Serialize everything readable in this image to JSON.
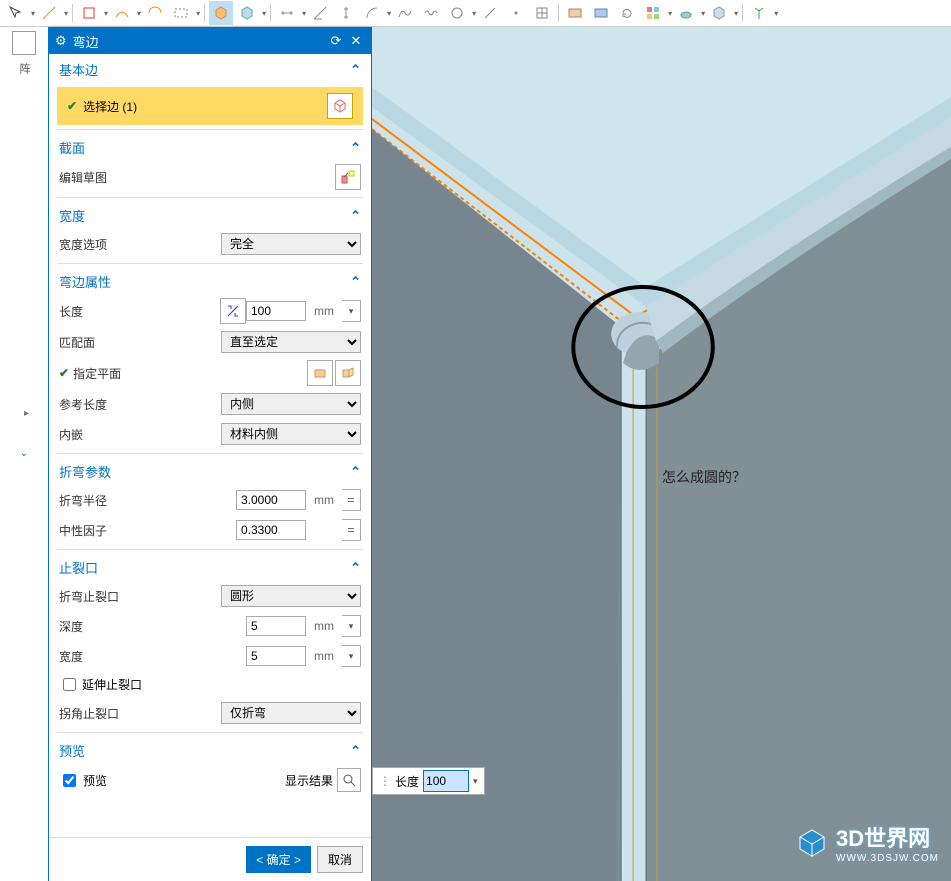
{
  "panel": {
    "title": "弯边",
    "section_basic": "基本边",
    "select_edge": "选择边 (1)",
    "section_cross": "截面",
    "edit_sketch": "编辑草图",
    "section_width": "宽度",
    "width_option_label": "宽度选项",
    "width_option_value": "完全",
    "section_bend_props": "弯边属性",
    "length_label": "长度",
    "length_value": "100",
    "length_unit": "mm",
    "match_face_label": "匹配面",
    "match_face_value": "直至选定",
    "specify_plane": "指定平面",
    "ref_length_label": "参考长度",
    "ref_length_value": "内侧",
    "inset_label": "内嵌",
    "inset_value": "材料内侧",
    "section_fold_params": "折弯参数",
    "bend_radius_label": "折弯半径",
    "bend_radius_value": "3.0000",
    "bend_radius_unit": "mm",
    "neutral_factor_label": "中性因子",
    "neutral_factor_value": "0.3300",
    "section_relief": "止裂口",
    "bend_relief_label": "折弯止裂口",
    "bend_relief_value": "圆形",
    "depth_label": "深度",
    "depth_value": "5",
    "depth_unit": "mm",
    "width2_label": "宽度",
    "width2_value": "5",
    "width2_unit": "mm",
    "extend_relief": "延伸止裂口",
    "corner_relief_label": "拐角止裂口",
    "corner_relief_value": "仅折弯",
    "section_preview": "预览",
    "preview_chk": "预览",
    "show_result": "显示结果",
    "ok": "< 确定 >",
    "cancel": "取消"
  },
  "floatbar": {
    "length_label": "长度",
    "length_value": "100"
  },
  "viewport": {
    "annotation": "怎么成圆的？"
  },
  "watermark": {
    "title": "3D世界网",
    "url": "WWW.3DSJW.COM"
  },
  "leftcol": {
    "label": "阵"
  }
}
